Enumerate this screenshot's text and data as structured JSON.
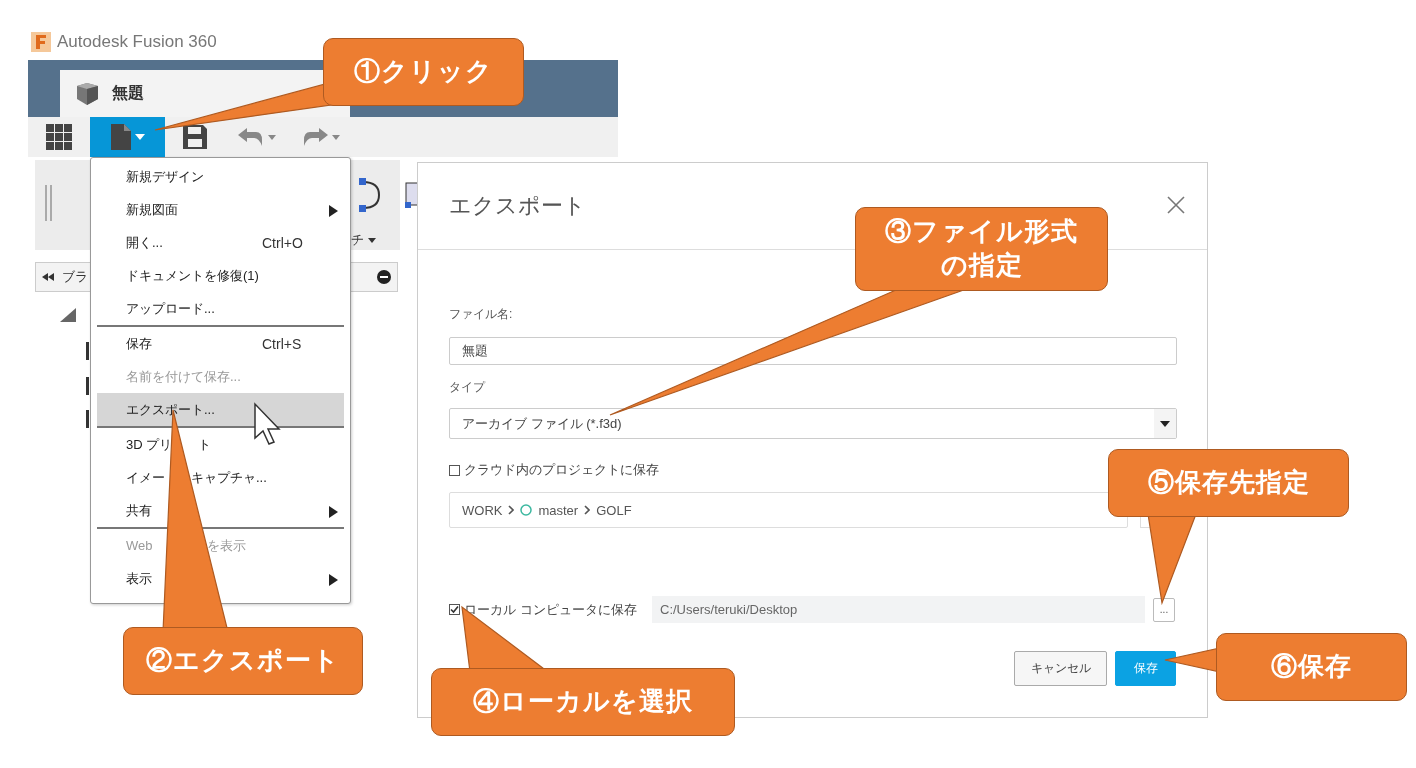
{
  "window": {
    "title": "Autodesk Fusion 360"
  },
  "document_tab": {
    "title": "無題"
  },
  "file_button": {
    "selected": true
  },
  "panel": {
    "tool_label": "チ",
    "browser_label": "ブラ"
  },
  "file_menu": {
    "items": [
      {
        "kind": "item",
        "label": "新規デザイン",
        "submenu": false,
        "disabled": false,
        "selected": false
      },
      {
        "kind": "item",
        "label": "新規図面",
        "submenu": true,
        "disabled": false,
        "selected": false
      },
      {
        "kind": "item",
        "label": "開く...",
        "shortcut": "Ctrl+O",
        "submenu": false,
        "disabled": false,
        "selected": false
      },
      {
        "kind": "item",
        "label": "ドキュメントを修復(1)",
        "submenu": false,
        "disabled": false,
        "selected": false
      },
      {
        "kind": "item",
        "label": "アップロード...",
        "submenu": false,
        "disabled": false,
        "selected": false
      },
      {
        "kind": "divider"
      },
      {
        "kind": "item",
        "label": "保存",
        "shortcut": "Ctrl+S",
        "submenu": false,
        "disabled": false,
        "selected": false
      },
      {
        "kind": "item",
        "label": "名前を付けて保存...",
        "submenu": false,
        "disabled": true,
        "selected": false
      },
      {
        "kind": "item",
        "label": "エクスポート...",
        "submenu": false,
        "disabled": false,
        "selected": true
      },
      {
        "kind": "divider"
      },
      {
        "kind": "item",
        "label": "3D プリ",
        "label_tail": "ト",
        "submenu": false,
        "disabled": false,
        "selected": false
      },
      {
        "kind": "item",
        "label": "イメー",
        "label_tail": "キャプチャ...",
        "submenu": false,
        "disabled": false,
        "selected": false
      },
      {
        "kind": "item",
        "label": "共有",
        "submenu": true,
        "disabled": false,
        "selected": false
      },
      {
        "kind": "divider"
      },
      {
        "kind": "item",
        "label": "Web",
        "label_tail": "を表示",
        "submenu": false,
        "disabled": true,
        "selected": false
      },
      {
        "kind": "item",
        "label": "表示",
        "submenu": true,
        "disabled": false,
        "selected": false
      }
    ]
  },
  "dialog": {
    "title": "エクスポート",
    "file_name": {
      "label": "ファイル名:",
      "value": "無題"
    },
    "type": {
      "label": "タイプ",
      "value": "アーカイブ ファイル (*.f3d)"
    },
    "cloud": {
      "label": "クラウド内のプロジェクトに保存",
      "checked": false,
      "path": [
        "WORK",
        "master",
        "GOLF"
      ]
    },
    "local": {
      "label": "ローカル コンピュータに保存",
      "checked": true,
      "path": "C:/Users/teruki/Desktop",
      "browse": "..."
    },
    "buttons": [
      {
        "label": "キャンセル",
        "kind": "secondary"
      },
      {
        "label": "保存",
        "kind": "primary"
      }
    ]
  },
  "callouts": [
    {
      "text": "①クリック"
    },
    {
      "text": "②エクスポート"
    },
    {
      "text": "③ファイル形式の指定"
    },
    {
      "text": "④ローカルを選択"
    },
    {
      "text": "⑤保存先指定"
    },
    {
      "text": "⑥保存"
    }
  ]
}
